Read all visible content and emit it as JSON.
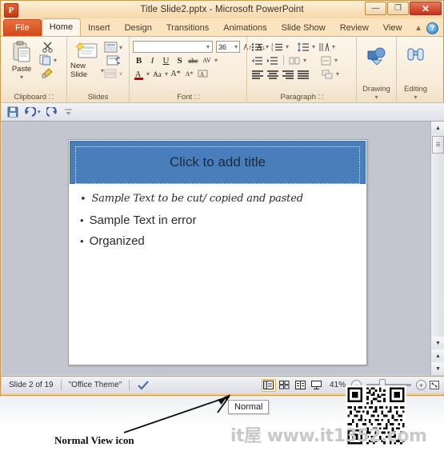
{
  "window": {
    "app_badge": "P",
    "title": "Title Slide2.pptx  -  Microsoft PowerPoint",
    "buttons": {
      "minimize": "—",
      "maximize": "❐",
      "close": "✕"
    }
  },
  "tabs": [
    {
      "label": "File",
      "type": "file"
    },
    {
      "label": "Home",
      "type": "active"
    },
    {
      "label": "Insert",
      "type": "normal"
    },
    {
      "label": "Design",
      "type": "normal"
    },
    {
      "label": "Transitions",
      "type": "normal"
    },
    {
      "label": "Animations",
      "type": "normal"
    },
    {
      "label": "Slide Show",
      "type": "normal"
    },
    {
      "label": "Review",
      "type": "normal"
    },
    {
      "label": "View",
      "type": "normal"
    }
  ],
  "tab_right": {
    "minimize_ribbon_icon": "chevron-up-icon",
    "help_label": "?"
  },
  "ribbon": {
    "groups": [
      {
        "name": "Clipboard",
        "label": "Clipboard",
        "has_dialog_launcher": true,
        "items": [
          {
            "name": "paste-button",
            "label": "Paste",
            "icon": "clipboard-icon"
          },
          {
            "name": "cut-button",
            "label": "",
            "icon": "scissors-icon"
          },
          {
            "name": "copy-button",
            "label": "",
            "icon": "copy-icon"
          },
          {
            "name": "format-painter-button",
            "label": "",
            "icon": "paintbrush-icon"
          }
        ]
      },
      {
        "name": "Slides",
        "label": "Slides",
        "has_dialog_launcher": false,
        "items": [
          {
            "name": "new-slide-button",
            "label": "New Slide",
            "icon": "new-slide-icon"
          },
          {
            "name": "layout-button",
            "label": "",
            "icon": "layout-icon"
          },
          {
            "name": "reset-button",
            "label": "",
            "icon": "reset-icon"
          },
          {
            "name": "section-button",
            "label": "",
            "icon": "section-icon"
          }
        ]
      },
      {
        "name": "Font",
        "label": "Font",
        "has_dialog_launcher": true,
        "font_name_value": "",
        "font_size_value": "36",
        "buttons_row1": [
          "B",
          "I",
          "U",
          "S",
          "abc",
          "AV"
        ],
        "buttons_row2": [
          "A",
          "Aa",
          "A",
          "A",
          "clear-formatting"
        ]
      },
      {
        "name": "Paragraph",
        "label": "Paragraph",
        "has_dialog_launcher": true
      },
      {
        "name": "Drawing",
        "label": "Drawing",
        "icon": "shapes-icon"
      },
      {
        "name": "Editing",
        "label": "Editing",
        "icon": "binoculars-icon"
      }
    ]
  },
  "quick_access": {
    "items": [
      {
        "name": "save-button",
        "icon": "floppy-disk-icon"
      },
      {
        "name": "undo-button",
        "icon": "undo-arrow-icon"
      },
      {
        "name": "redo-button",
        "icon": "redo-arrow-icon"
      },
      {
        "name": "customize-qat-button",
        "icon": "chevron-down-icon"
      }
    ]
  },
  "slide": {
    "title_placeholder": "Click to add title",
    "bullets": [
      {
        "text": "Sample Text to be cut/ copied and pasted",
        "style": "script"
      },
      {
        "text": "Sample Text in error",
        "style": "normal"
      },
      {
        "text": "Organized",
        "style": "normal"
      }
    ],
    "title_band_color": "#4a7ebb"
  },
  "status_bar": {
    "slide_counter": "Slide 2 of 19",
    "theme": "\"Office Theme\"",
    "spelling_icon": "spell-check-icon",
    "views": [
      {
        "name": "normal-view-button",
        "icon": "normal-view-icon",
        "selected": true
      },
      {
        "name": "slide-sorter-view-button",
        "icon": "slide-sorter-icon",
        "selected": false
      },
      {
        "name": "reading-view-button",
        "icon": "reading-view-icon",
        "selected": false
      },
      {
        "name": "slide-show-button",
        "icon": "slide-show-icon",
        "selected": false
      }
    ],
    "zoom_level": "41%",
    "zoom_out_label": "−",
    "fit_window_icon": "fit-to-window-icon"
  },
  "tooltip": {
    "text": "Normal"
  },
  "annotation": {
    "text": "Normal View icon"
  },
  "watermark": {
    "text": "it屋 www.it1352.com"
  }
}
